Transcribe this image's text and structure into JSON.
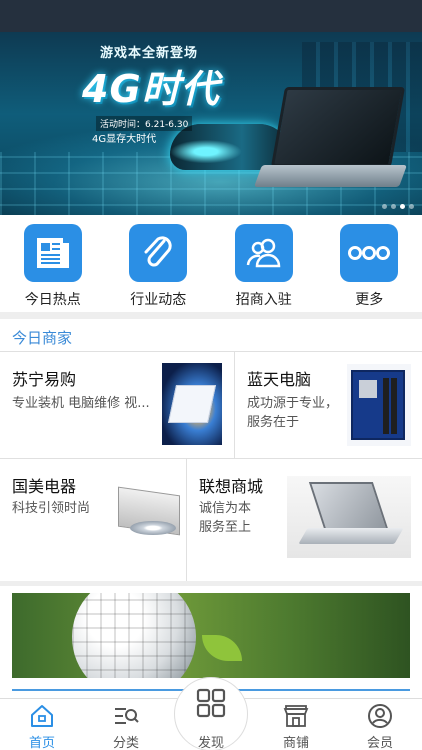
{
  "banner": {
    "promo_title": "游戏本全新登场",
    "headline": "4G时代",
    "date": "活动时间：6.21-6.30",
    "subtitle": "4G显存大时代",
    "slides_total": 4,
    "active_slide": 3
  },
  "quicknav": [
    {
      "label": "今日热点",
      "icon": "newspaper-icon"
    },
    {
      "label": "行业动态",
      "icon": "paperclip-icon"
    },
    {
      "label": "招商入驻",
      "icon": "users-icon"
    },
    {
      "label": "更多",
      "icon": "more-dots-icon"
    }
  ],
  "merchants_section": {
    "title": "今日商家",
    "items": [
      {
        "name": "苏宁易购",
        "desc": "专业装机 电脑维修 视..."
      },
      {
        "name": "蓝天电脑",
        "desc": "成功源于专业，服务在于"
      },
      {
        "name": "国美电器",
        "desc": "科技引领时尚"
      },
      {
        "name": "联想商城",
        "desc": "诚信为本 服务至上"
      }
    ]
  },
  "tabbar": [
    {
      "label": "首页",
      "icon": "home-icon",
      "active": true
    },
    {
      "label": "分类",
      "icon": "category-search-icon",
      "active": false
    },
    {
      "label": "发现",
      "icon": "grid-icon",
      "active": false
    },
    {
      "label": "商铺",
      "icon": "shop-icon",
      "active": false
    },
    {
      "label": "会员",
      "icon": "user-icon",
      "active": false
    }
  ],
  "colors": {
    "accent": "#2b8fe5",
    "section_title": "#3a8ad7",
    "statusbar": "#25303e"
  }
}
